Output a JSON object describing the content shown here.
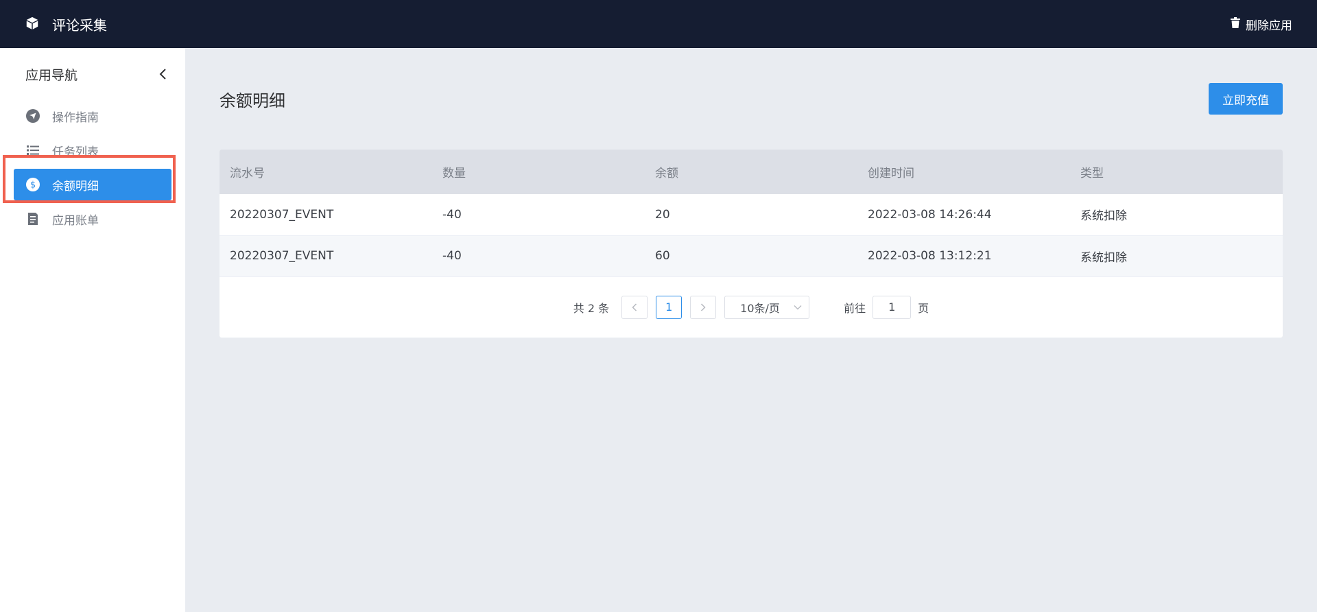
{
  "header": {
    "app_title": "评论采集",
    "delete_label": "删除应用"
  },
  "sidebar": {
    "title": "应用导航",
    "items": [
      {
        "label": "操作指南",
        "icon": "navigation-icon",
        "active": false
      },
      {
        "label": "任务列表",
        "icon": "list-icon",
        "active": false
      },
      {
        "label": "余额明细",
        "icon": "dollar-icon",
        "active": true
      },
      {
        "label": "应用账单",
        "icon": "bill-icon",
        "active": false
      }
    ]
  },
  "main": {
    "title": "余额明细",
    "recharge_label": "立即充值",
    "table": {
      "columns": [
        "流水号",
        "数量",
        "余额",
        "创建时间",
        "类型"
      ],
      "rows": [
        [
          "20220307_EVENT",
          "-40",
          "20",
          "2022-03-08 14:26:44",
          "系统扣除"
        ],
        [
          "20220307_EVENT",
          "-40",
          "60",
          "2022-03-08 13:12:21",
          "系统扣除"
        ]
      ]
    },
    "pagination": {
      "total_text": "共 2 条",
      "current_page": "1",
      "page_size": "10条/页",
      "goto_prefix": "前往",
      "goto_value": "1",
      "goto_suffix": "页"
    }
  },
  "colors": {
    "topbar": "#151d32",
    "accent": "#2d8ee9",
    "highlight": "#f0614f"
  }
}
